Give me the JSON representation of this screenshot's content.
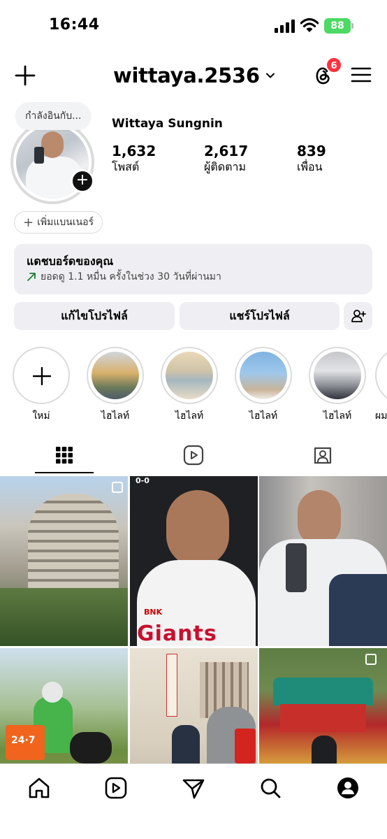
{
  "status_bar": {
    "time": "16:44",
    "battery": "88"
  },
  "header": {
    "username": "wittaya.2536",
    "threads_badge": "6"
  },
  "profile": {
    "note": "กำลังอินกับ...",
    "display_name": "Wittaya Sungnin",
    "stats": [
      {
        "value": "1,632",
        "label": "โพสต์"
      },
      {
        "value": "2,617",
        "label": "ผู้ติดตาม"
      },
      {
        "value": "839",
        "label": "เพื่อน"
      }
    ],
    "add_banner": "เพิ่มแบนเนอร์"
  },
  "dashboard": {
    "title": "แดชบอร์ดของคุณ",
    "subtitle": "ยอดดู 1.1 หมื่น ครั้งในช่วง 30 วันที่ผ่านมา"
  },
  "actions": {
    "edit_profile": "แก้ไขโปรไฟล์",
    "share_profile": "แชร์โปรไฟล์"
  },
  "highlights": [
    {
      "label": "ใหม่"
    },
    {
      "label": "ไฮไลท์"
    },
    {
      "label": "ไฮไลท์"
    },
    {
      "label": "ไฮไลท์"
    },
    {
      "label": "ไฮไลท์"
    },
    {
      "label": "ผม"
    }
  ],
  "tabs": [
    "grid-icon",
    "reels-icon",
    "tagged-icon"
  ],
  "grid": {
    "posts": [
      {
        "text": ""
      },
      {
        "text": "BNK",
        "overlay": "Giants",
        "score": "0-0"
      },
      {
        "text": ""
      },
      {
        "text": "24·7"
      },
      {
        "text": ""
      },
      {
        "text": ""
      }
    ]
  },
  "bottom_nav": [
    "home-icon",
    "reels-icon",
    "messages-icon",
    "search-icon",
    "profile-icon"
  ],
  "colors": {
    "badge": "#ff3040",
    "battery": "#4cd964",
    "pill_bg": "#efeff3"
  }
}
